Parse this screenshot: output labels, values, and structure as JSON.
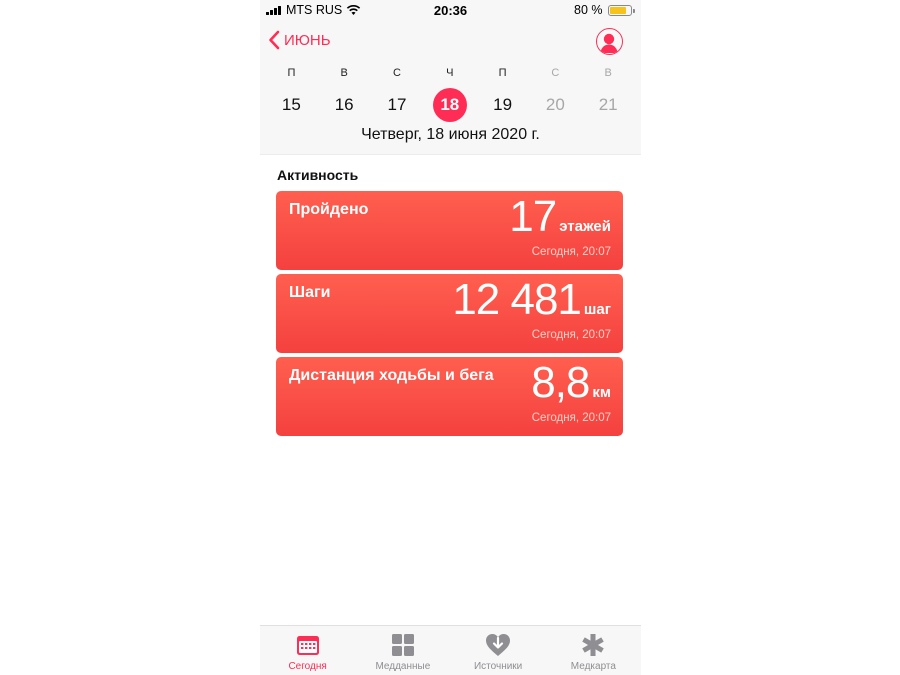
{
  "status_bar": {
    "carrier": "MTS RUS",
    "time": "20:36",
    "battery_percent": "80 %",
    "battery_level": 0.8,
    "battery_color": "#f6c21c"
  },
  "header": {
    "back_label": "ИЮНЬ",
    "back_icon": "chevron-left-icon",
    "profile_icon": "profile-icon",
    "weekdays": [
      "П",
      "В",
      "С",
      "Ч",
      "П",
      "С",
      "В"
    ],
    "dates": [
      "15",
      "16",
      "17",
      "18",
      "19",
      "20",
      "21"
    ],
    "selected_date": "18",
    "full_date": "Четверг, 18 июня 2020 г."
  },
  "activity": {
    "title": "Активность",
    "cards": [
      {
        "label": "Пройдено",
        "value": "17",
        "unit": "этажей",
        "time": "Сегодня, 20:07"
      },
      {
        "label": "Шаги",
        "value": "12 481",
        "unit": "шаг",
        "time": "Сегодня, 20:07"
      },
      {
        "label": "Дистанция ходьбы и бега",
        "value": "8,8",
        "unit": "км",
        "time": "Сегодня, 20:07"
      }
    ]
  },
  "tabs": [
    {
      "label": "Сегодня",
      "icon": "calendar-icon",
      "active": true
    },
    {
      "label": "Медданные",
      "icon": "grid-icon",
      "active": false
    },
    {
      "label": "Источники",
      "icon": "heart-download-icon",
      "active": false
    },
    {
      "label": "Медкарта",
      "icon": "asterisk-icon",
      "active": false
    }
  ],
  "colors": {
    "accent": "#ff2d55",
    "card_top": "#ff5f4f",
    "card_bottom": "#f4413f",
    "inactive_tab": "#8e8e93"
  }
}
